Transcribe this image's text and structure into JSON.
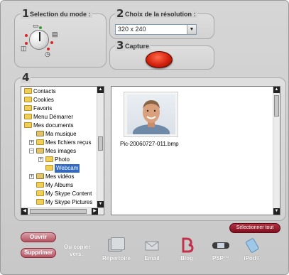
{
  "step1": {
    "number": "1",
    "title": "Selection du mode :"
  },
  "step2": {
    "number": "2",
    "title": "Choix de la résolution :",
    "resolution_value": "320 x 240"
  },
  "step3": {
    "number": "3",
    "title": "Capture"
  },
  "step4": {
    "number": "4"
  },
  "tree": {
    "items": [
      {
        "label": "Contacts"
      },
      {
        "label": "Cookies"
      },
      {
        "label": "Favoris"
      },
      {
        "label": "Menu Démarrer"
      },
      {
        "label": "Mes documents"
      },
      {
        "label": "Ma musique"
      },
      {
        "label": "Mes fichiers reçus"
      },
      {
        "label": "Mes images"
      },
      {
        "label": "Photo"
      },
      {
        "label": "Webcam"
      },
      {
        "label": "Mes vidéos"
      },
      {
        "label": "My Albums"
      },
      {
        "label": "My Skype Content"
      },
      {
        "label": "My Skype Pictures"
      }
    ]
  },
  "preview": {
    "file_name": "Pic-20060727-011.bmp"
  },
  "buttons": {
    "select_all": "Sélectionner tout",
    "open": "Ouvrir",
    "delete": "Supprimer"
  },
  "copy_to": {
    "label_line1": "Ou copier",
    "label_line2": "vers:",
    "destinations": [
      {
        "label": "Répertoire",
        "icon": "folder-stack-icon"
      },
      {
        "label": "Email",
        "icon": "envelope-icon"
      },
      {
        "label": "Blog",
        "icon": "blog-icon"
      },
      {
        "label": "PSP™",
        "icon": "psp-icon"
      },
      {
        "label": "iPod®",
        "icon": "ipod-icon"
      }
    ]
  },
  "colors": {
    "capture_red": "#d3210d",
    "selection_blue": "#316ac5",
    "button_maroon": "#7d1020",
    "blog_pink": "#c2324a"
  }
}
